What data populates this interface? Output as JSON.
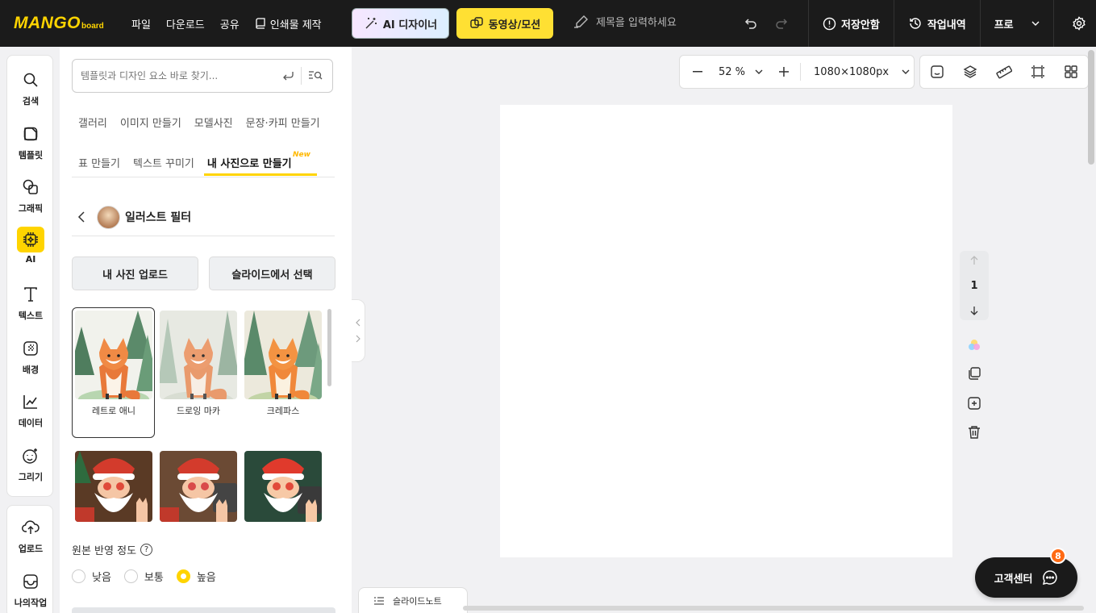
{
  "topbar": {
    "logo_main": "MANGO",
    "logo_sub": "board",
    "menu": [
      "파일",
      "다운로드",
      "공유",
      "인쇄물 제작"
    ],
    "ai_button": "AI 디자이너",
    "video_button": "동영상/모션",
    "title_placeholder": "제목을 입력하세요",
    "save_status": "저장안함",
    "history": "작업내역",
    "plan": "프로"
  },
  "sidebar": {
    "items": [
      {
        "label": "검색",
        "icon": "search-icon"
      },
      {
        "label": "템플릿",
        "icon": "template-icon"
      },
      {
        "label": "그래픽",
        "icon": "graphic-icon"
      },
      {
        "label": "AI",
        "icon": "ai-chip-icon"
      },
      {
        "label": "텍스트",
        "icon": "text-icon"
      },
      {
        "label": "배경",
        "icon": "background-icon"
      },
      {
        "label": "데이터",
        "icon": "chart-icon"
      },
      {
        "label": "그리기",
        "icon": "draw-icon"
      }
    ],
    "bottom_items": [
      {
        "label": "업로드",
        "icon": "upload-icon"
      },
      {
        "label": "나의작업",
        "icon": "my-work-icon"
      }
    ]
  },
  "panel": {
    "search_placeholder": "템플릿과 디자인 요소 바로 찾기...",
    "tabs_row1": [
      "갤러리",
      "이미지 만들기",
      "모델사진",
      "문장·카피 만들기"
    ],
    "tabs_row2": [
      "표 만들기",
      "텍스트 꾸미기",
      "내 사진으로 만들기"
    ],
    "new_badge": "New",
    "filter_title": "일러스트 필터",
    "upload_button": "내 사진 업로드",
    "slide_button": "슬라이드에서 선택",
    "thumbs": [
      {
        "caption": "레트로 애니"
      },
      {
        "caption": "드로잉 마카"
      },
      {
        "caption": "크레파스"
      }
    ],
    "reflect_label": "원본 반영 정도",
    "help_glyph": "?",
    "radios": [
      {
        "label": "낮음",
        "selected": false
      },
      {
        "label": "보통",
        "selected": false
      },
      {
        "label": "높음",
        "selected": true
      }
    ]
  },
  "canvas": {
    "zoom": "52 %",
    "size": "1080×1080px",
    "page_number": "1"
  },
  "footer": {
    "slide_note": "슬라이드노트",
    "cs_label": "고객센터",
    "cs_badge": "8"
  },
  "colors": {
    "accent": "#ffd400",
    "topbar_bg": "#1b1b1b",
    "badge": "#ff6a13"
  }
}
